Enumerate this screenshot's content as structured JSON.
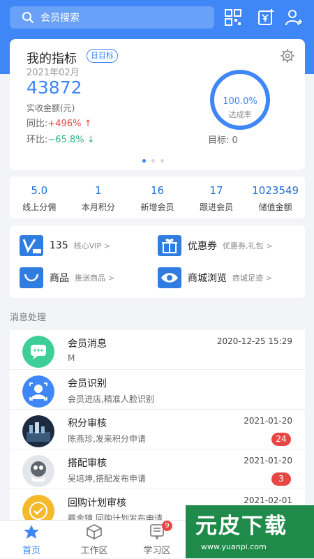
{
  "header": {
    "search_placeholder": "会员搜索",
    "icons": [
      "qrcode-icon",
      "wallet-icon",
      "add-user-icon"
    ]
  },
  "metrics": {
    "title": "我的指标",
    "tag": "日目标",
    "month": "2021年02月",
    "amount": "43872",
    "amount_label": "实收金额(元)",
    "yoy_label": "同比:",
    "yoy_value": "+496% ↑",
    "mom_label": "环比:",
    "mom_value": "−65.8% ↓",
    "rate_value": "100.0%",
    "rate_fraction": 1.0,
    "rate_label": "达成率",
    "target": "目标: 0",
    "colors": {
      "accent": "#3f86f6",
      "up": "#e84545",
      "down": "#2fb67e"
    }
  },
  "stats": [
    {
      "value": "5.0",
      "label": "线上分佣"
    },
    {
      "value": "1",
      "label": "本月积分"
    },
    {
      "value": "16",
      "label": "新增会员"
    },
    {
      "value": "17",
      "label": "跟进会员"
    },
    {
      "value": "1023549",
      "label": "储值金额"
    }
  ],
  "quick": [
    {
      "name": "135",
      "sub": "核心VIP",
      "icon": "vip-icon"
    },
    {
      "name": "优惠券",
      "sub": "优惠券,礼包",
      "icon": "gift-icon"
    },
    {
      "name": "商品",
      "sub": "推送商品",
      "icon": "bag-icon"
    },
    {
      "name": "商城浏览",
      "sub": "商城足迹",
      "icon": "eye-icon"
    }
  ],
  "section_title": "消息处理",
  "messages": [
    {
      "title": "会员消息",
      "desc": "M",
      "time": "2020-12-25 15:29",
      "count": ""
    },
    {
      "title": "会员识别",
      "desc": "会员进店,精准人脸识别",
      "time": "",
      "count": ""
    },
    {
      "title": "积分审核",
      "desc": "陈燕珍,发来积分申请",
      "time": "2021-01-20",
      "count": "24"
    },
    {
      "title": "搭配审核",
      "desc": "吴培坤,搭配发布申请",
      "time": "2021-01-20",
      "count": "3"
    },
    {
      "title": "回购计划审核",
      "desc": "蔡金镜,回购计划发布申请",
      "time": "2021-02-01",
      "count": ""
    }
  ],
  "tabs": [
    {
      "label": "首页",
      "badge": ""
    },
    {
      "label": "工作区",
      "badge": ""
    },
    {
      "label": "学习区",
      "badge": "9"
    }
  ],
  "watermark": {
    "title": "元皮下载",
    "url": "www.yuanpi.com"
  }
}
